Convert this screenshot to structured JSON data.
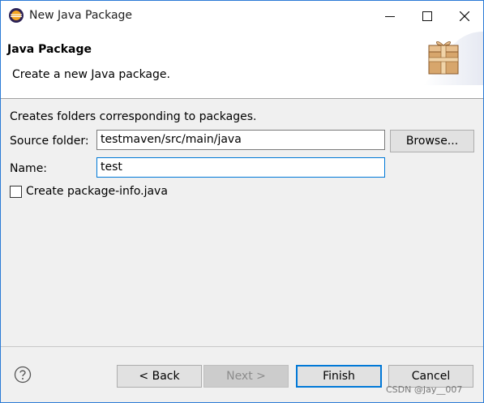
{
  "window": {
    "title": "New Java Package"
  },
  "banner": {
    "title": "Java Package",
    "description": "Create a new Java package."
  },
  "form": {
    "description": "Creates folders corresponding to packages.",
    "source_folder_label": "Source folder:",
    "source_folder_value": "testmaven/src/main/java",
    "browse_label": "Browse...",
    "name_label": "Name:",
    "name_value": "test",
    "package_info_label": "Create package-info.java",
    "package_info_checked": false
  },
  "footer": {
    "back_label": "< Back",
    "next_label": "Next >",
    "finish_label": "Finish",
    "cancel_label": "Cancel"
  },
  "watermark": "CSDN @Jay__007",
  "icons": [
    "eclipse-app-icon",
    "minimize-icon",
    "maximize-icon",
    "close-icon",
    "package-banner-icon",
    "help-icon"
  ],
  "colors": {
    "accent": "#0078d7",
    "window_border": "#2b7bd6",
    "dialog_bg": "#f0f0f0"
  }
}
